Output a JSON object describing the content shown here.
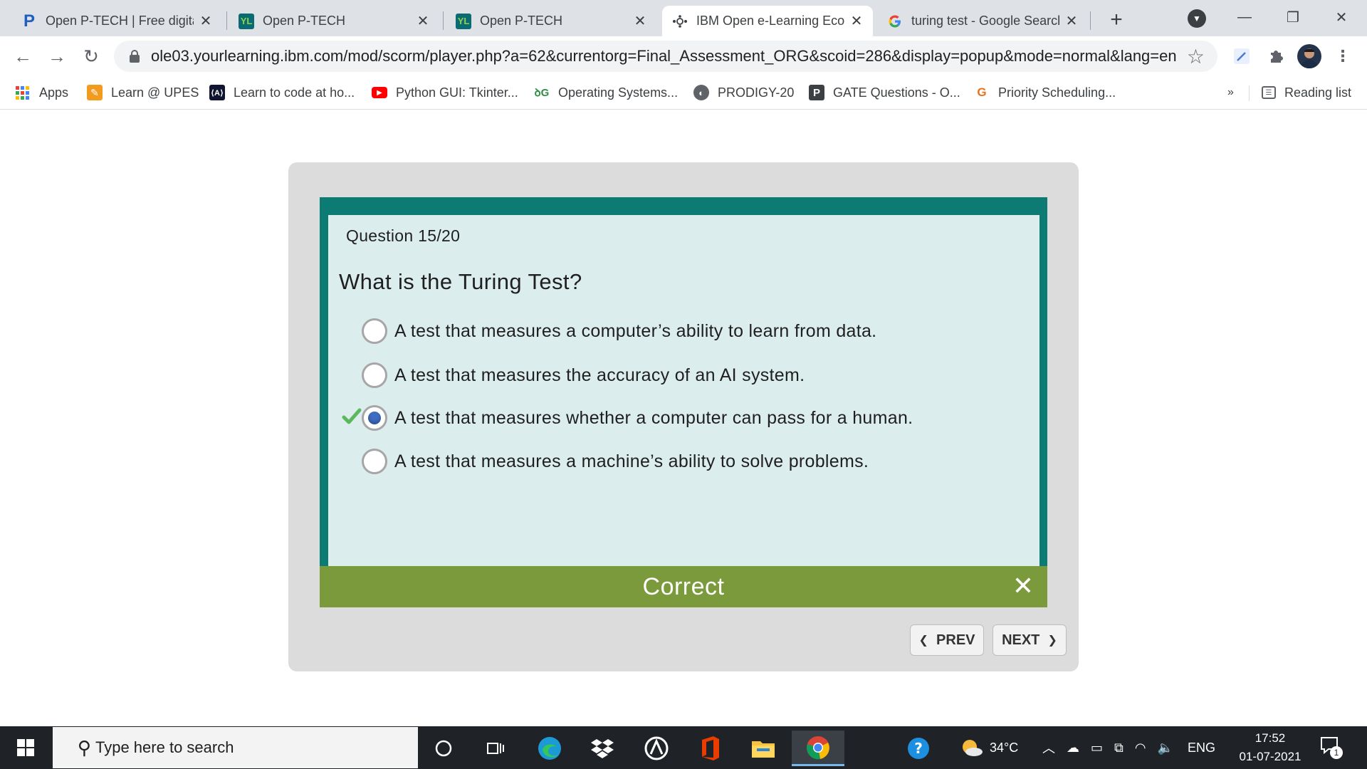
{
  "browser": {
    "tabs": [
      {
        "title": "Open P-TECH | Free digital",
        "icon": "ptech-logo-icon",
        "active": false
      },
      {
        "title": "Open P-TECH",
        "icon": "yourlearning-logo-icon",
        "active": false
      },
      {
        "title": "Open P-TECH",
        "icon": "yourlearning-logo-icon",
        "active": false
      },
      {
        "title": "IBM Open e-Learning Eco",
        "icon": "ibm-ecosystem-icon",
        "active": true
      },
      {
        "title": "turing test - Google Search",
        "icon": "google-logo-icon",
        "active": false
      }
    ],
    "url": "ole03.yourlearning.ibm.com/mod/scorm/player.php?a=62&currentorg=Final_Assessment_ORG&scoid=286&display=popup&mode=normal&lang=en",
    "bookmarks": [
      {
        "label": "Apps",
        "icon": "apps-grid-icon"
      },
      {
        "label": "Learn @ UPES",
        "icon": "pencil-icon"
      },
      {
        "label": "Learn to code at ho...",
        "icon": "codecademy-icon"
      },
      {
        "label": "Python GUI: Tkinter...",
        "icon": "youtube-icon"
      },
      {
        "label": "Operating Systems...",
        "icon": "geeksforgeeks-icon"
      },
      {
        "label": "PRODIGY-20",
        "icon": "globe-icon"
      },
      {
        "label": "GATE Questions - O...",
        "icon": "p-logo-icon"
      },
      {
        "label": "Priority Scheduling...",
        "icon": "g-logo-icon"
      }
    ],
    "overflow_label": "»",
    "reading_list": "Reading list"
  },
  "quiz": {
    "question_number": "Question 15/20",
    "question": "What is the Turing Test?",
    "options": [
      {
        "label": "A test that measures a computer’s ability to learn from data.",
        "selected": false
      },
      {
        "label": "A test that measures the accuracy of an AI system.",
        "selected": false
      },
      {
        "label": "A test that measures whether a computer can pass for a human.",
        "selected": true
      },
      {
        "label": "A test that measures a machine’s ability to solve problems.",
        "selected": false
      }
    ],
    "feedback": "Correct",
    "prev_label": "PREV",
    "next_label": "NEXT",
    "colors": {
      "frame": "#0c7b74",
      "panel": "#dcedee",
      "feedback": "#7b9a3c",
      "radio_selected": "#3e6cc2",
      "check": "#5cb85c"
    }
  },
  "taskbar": {
    "search_placeholder": "Type here to search",
    "temperature": "34°C",
    "language": "ENG",
    "time": "17:52",
    "date": "01-07-2021",
    "notification_count": "1"
  }
}
